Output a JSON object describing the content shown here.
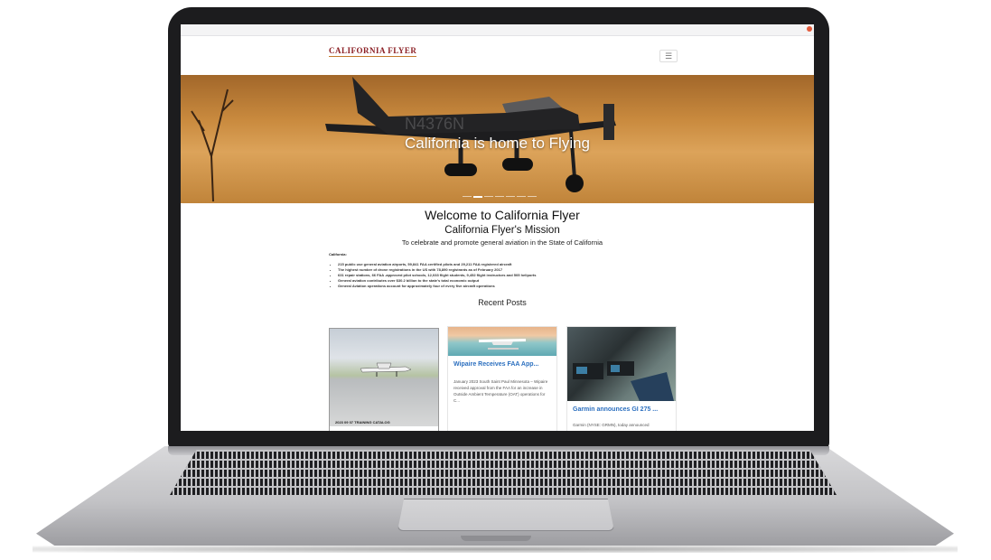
{
  "site": {
    "logo_text": "CALIFORNIA FLYER",
    "menu_icon": "hamburger-icon"
  },
  "hero": {
    "title": "California is home to Flying",
    "aircraft_registration": "N4376N",
    "slide_count": 7,
    "active_slide": 2
  },
  "main": {
    "welcome": "Welcome to California Flyer",
    "mission_title": "California Flyer's Mission",
    "mission_text": "To celebrate and promote general aviation in the State of California",
    "state_label": "California:",
    "facts": [
      "215 public use general aviation airports, 59,841 FAA certified pilots and 29,211 FAA registered aircraft",
      "The highest number of drone registrations in the US with 78,890 registrants as of February 2017",
      "631 repair stations, 66 FAA -approved pilot schools, 12,033 flight students, 9,452 flight instructors and 505 heliports",
      "General aviation contributes over $30.2 billion to the state's total economic output",
      "General Aviation operations account for approximately four of every five aircraft operations"
    ]
  },
  "recent_posts": {
    "heading": "Recent Posts",
    "posts": [
      {
        "title": "",
        "caption": "2023 09 07 TRAINING CATALOG",
        "excerpt": ""
      },
      {
        "title": "Wipaire Receives FAA App...",
        "caption": "",
        "excerpt": "January 2023 South Saint Paul Minnesota – Wipaire received approval from the FAA for an increase in Outside Ambient Temperature (OAT) operations for C..."
      },
      {
        "title": "Garmin announces GI 275 ...",
        "caption": "",
        "excerpt": "Garmin (NYSE: GRMN), today announced"
      }
    ]
  },
  "colors": {
    "laptop_bezel": "#1c1c1e",
    "hero_sky": "#c98a3e",
    "logo_red": "#8b1f24",
    "link_blue": "#2b6fbf"
  }
}
